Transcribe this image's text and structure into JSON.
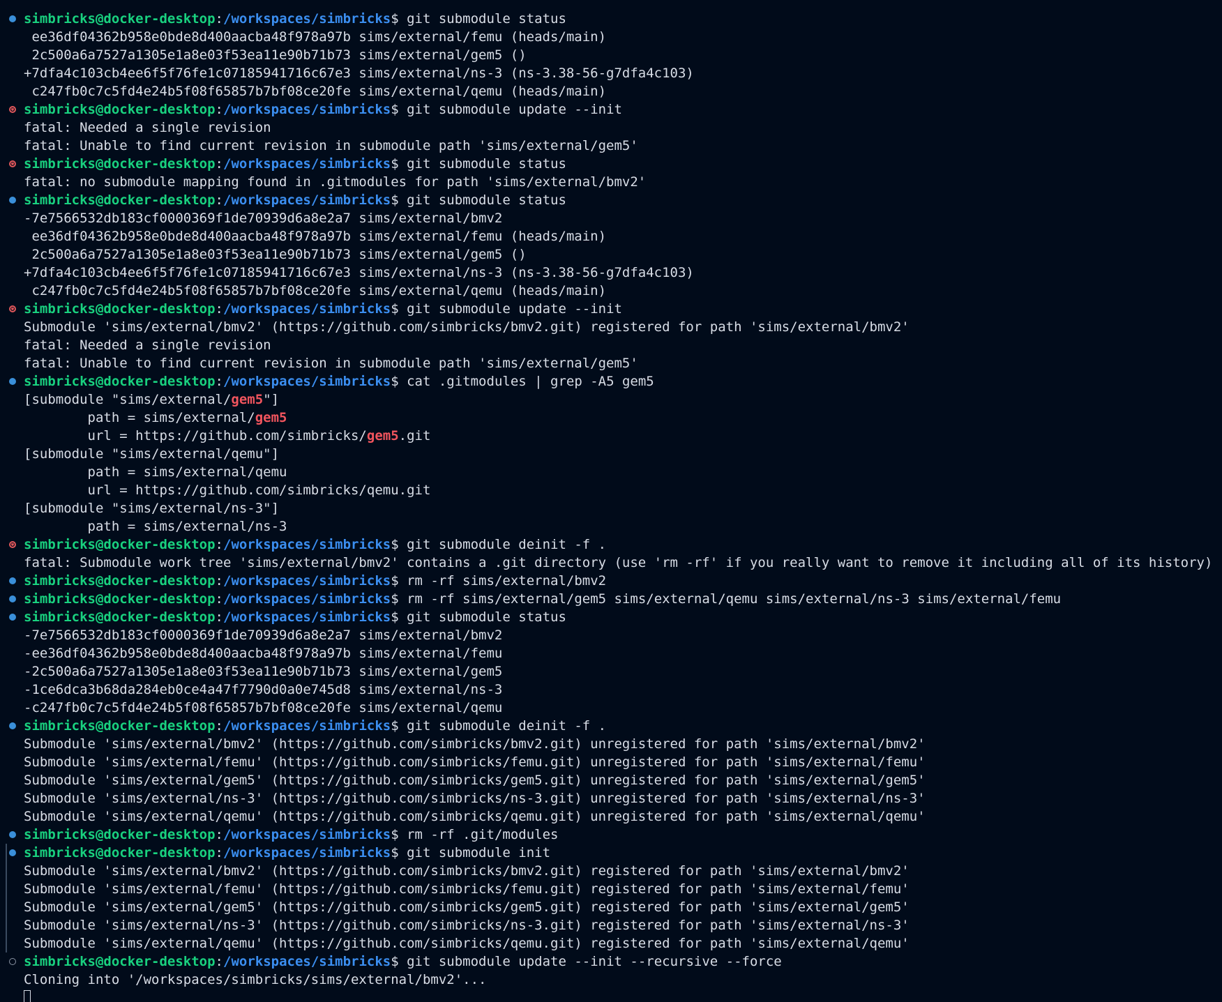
{
  "prompt": {
    "user": "simbricks@docker-desktop",
    "separator": ":",
    "path": "/workspaces/simbricks",
    "symbol": "$ "
  },
  "lines": [
    {
      "type": "cmd",
      "status": "success",
      "text": "git submodule status"
    },
    {
      "type": "out",
      "text": " ee36df04362b958e0bde8d400aacba48f978a97b sims/external/femu (heads/main)"
    },
    {
      "type": "out",
      "text": " 2c500a6a7527a1305e1a8e03f53ea11e90b71b73 sims/external/gem5 ()"
    },
    {
      "type": "out",
      "text": "+7dfa4c103cb4ee6f5f76fe1c07185941716c67e3 sims/external/ns-3 (ns-3.38-56-g7dfa4c103)"
    },
    {
      "type": "out",
      "text": " c247fb0c7c5fd4e24b5f08f65857b7bf08ce20fe sims/external/qemu (heads/main)"
    },
    {
      "type": "cmd",
      "status": "error",
      "text": "git submodule update --init"
    },
    {
      "type": "out",
      "text": "fatal: Needed a single revision"
    },
    {
      "type": "out",
      "text": "fatal: Unable to find current revision in submodule path 'sims/external/gem5'"
    },
    {
      "type": "cmd",
      "status": "error",
      "text": "git submodule status"
    },
    {
      "type": "out",
      "text": "fatal: no submodule mapping found in .gitmodules for path 'sims/external/bmv2'"
    },
    {
      "type": "cmd",
      "status": "success",
      "text": "git submodule status"
    },
    {
      "type": "out",
      "text": "-7e7566532db183cf0000369f1de70939d6a8e2a7 sims/external/bmv2"
    },
    {
      "type": "out",
      "text": " ee36df04362b958e0bde8d400aacba48f978a97b sims/external/femu (heads/main)"
    },
    {
      "type": "out",
      "text": " 2c500a6a7527a1305e1a8e03f53ea11e90b71b73 sims/external/gem5 ()"
    },
    {
      "type": "out",
      "text": "+7dfa4c103cb4ee6f5f76fe1c07185941716c67e3 sims/external/ns-3 (ns-3.38-56-g7dfa4c103)"
    },
    {
      "type": "out",
      "text": " c247fb0c7c5fd4e24b5f08f65857b7bf08ce20fe sims/external/qemu (heads/main)"
    },
    {
      "type": "cmd",
      "status": "error",
      "text": "git submodule update --init"
    },
    {
      "type": "out",
      "text": "Submodule 'sims/external/bmv2' (https://github.com/simbricks/bmv2.git) registered for path 'sims/external/bmv2'"
    },
    {
      "type": "out",
      "text": "fatal: Needed a single revision"
    },
    {
      "type": "out",
      "text": "fatal: Unable to find current revision in submodule path 'sims/external/gem5'"
    },
    {
      "type": "cmd",
      "status": "success",
      "text": "cat .gitmodules | grep -A5 gem5"
    },
    {
      "type": "hl",
      "parts": [
        "[submodule \"sims/external/",
        "gem5",
        "\"]"
      ]
    },
    {
      "type": "hl",
      "parts": [
        "        path = sims/external/",
        "gem5",
        ""
      ]
    },
    {
      "type": "hl",
      "parts": [
        "        url = https://github.com/simbricks/",
        "gem5",
        ".git"
      ]
    },
    {
      "type": "out",
      "text": "[submodule \"sims/external/qemu\"]"
    },
    {
      "type": "out",
      "text": "        path = sims/external/qemu"
    },
    {
      "type": "out",
      "text": "        url = https://github.com/simbricks/qemu.git"
    },
    {
      "type": "out",
      "text": "[submodule \"sims/external/ns-3\"]"
    },
    {
      "type": "out",
      "text": "        path = sims/external/ns-3"
    },
    {
      "type": "cmd",
      "status": "error",
      "text": "git submodule deinit -f ."
    },
    {
      "type": "out",
      "text": "fatal: Submodule work tree 'sims/external/bmv2' contains a .git directory (use 'rm -rf' if you really want to remove it including all of its history)"
    },
    {
      "type": "cmd",
      "status": "success",
      "text": "rm -rf sims/external/bmv2"
    },
    {
      "type": "cmd",
      "status": "success",
      "text": "rm -rf sims/external/gem5 sims/external/qemu sims/external/ns-3 sims/external/femu"
    },
    {
      "type": "cmd",
      "status": "success",
      "text": "git submodule status"
    },
    {
      "type": "out",
      "text": "-7e7566532db183cf0000369f1de70939d6a8e2a7 sims/external/bmv2"
    },
    {
      "type": "out",
      "text": "-ee36df04362b958e0bde8d400aacba48f978a97b sims/external/femu"
    },
    {
      "type": "out",
      "text": "-2c500a6a7527a1305e1a8e03f53ea11e90b71b73 sims/external/gem5"
    },
    {
      "type": "out",
      "text": "-1ce6dca3b68da284eb0ce4a47f7790d0a0e745d8 sims/external/ns-3"
    },
    {
      "type": "out",
      "text": "-c247fb0c7c5fd4e24b5f08f65857b7bf08ce20fe sims/external/qemu"
    },
    {
      "type": "cmd",
      "status": "success",
      "text": "git submodule deinit -f ."
    },
    {
      "type": "out",
      "text": "Submodule 'sims/external/bmv2' (https://github.com/simbricks/bmv2.git) unregistered for path 'sims/external/bmv2'"
    },
    {
      "type": "out",
      "text": "Submodule 'sims/external/femu' (https://github.com/simbricks/femu.git) unregistered for path 'sims/external/femu'"
    },
    {
      "type": "out",
      "text": "Submodule 'sims/external/gem5' (https://github.com/simbricks/gem5.git) unregistered for path 'sims/external/gem5'"
    },
    {
      "type": "out",
      "text": "Submodule 'sims/external/ns-3' (https://github.com/simbricks/ns-3.git) unregistered for path 'sims/external/ns-3'"
    },
    {
      "type": "out",
      "text": "Submodule 'sims/external/qemu' (https://github.com/simbricks/qemu.git) unregistered for path 'sims/external/qemu'"
    },
    {
      "type": "cmd",
      "status": "success",
      "text": "rm -rf .git/modules"
    },
    {
      "type": "cmd",
      "status": "success",
      "bar": true,
      "text": "git submodule init"
    },
    {
      "type": "out",
      "bar": true,
      "text": "Submodule 'sims/external/bmv2' (https://github.com/simbricks/bmv2.git) registered for path 'sims/external/bmv2'"
    },
    {
      "type": "out",
      "bar": true,
      "text": "Submodule 'sims/external/femu' (https://github.com/simbricks/femu.git) registered for path 'sims/external/femu'"
    },
    {
      "type": "out",
      "bar": true,
      "text": "Submodule 'sims/external/gem5' (https://github.com/simbricks/gem5.git) registered for path 'sims/external/gem5'"
    },
    {
      "type": "out",
      "bar": true,
      "text": "Submodule 'sims/external/ns-3' (https://github.com/simbricks/ns-3.git) registered for path 'sims/external/ns-3'"
    },
    {
      "type": "out",
      "bar": true,
      "text": "Submodule 'sims/external/qemu' (https://github.com/simbricks/qemu.git) registered for path 'sims/external/qemu'"
    },
    {
      "type": "cmd",
      "status": "pending",
      "text": "git submodule update --init --recursive --force"
    },
    {
      "type": "out",
      "text": "Cloning into '/workspaces/simbricks/sims/external/bmv2'..."
    },
    {
      "type": "cursor"
    }
  ]
}
